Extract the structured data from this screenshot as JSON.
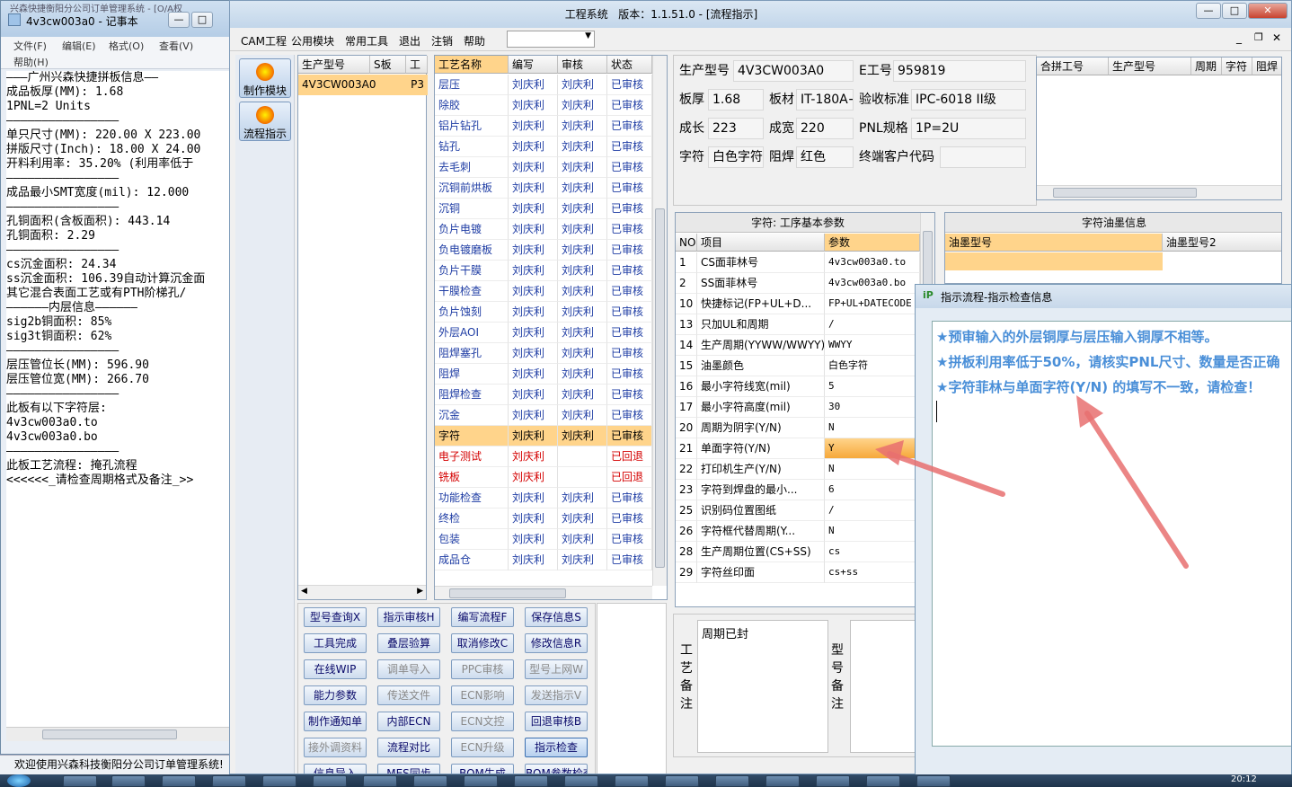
{
  "notepad": {
    "title": "4v3cw003a0 - 记事本",
    "partial_top": "兴森快捷衡阳分公司订单管理系统 - [O/A权",
    "menu": [
      "文件(F)",
      "编辑(E)",
      "格式(O)",
      "查看(V)",
      "帮助(H)"
    ],
    "lines": [
      "———广州兴森快捷拼板信息——",
      "成品板厚(MM): 1.68",
      "1PNL=2 Units",
      "————————————————",
      "单只尺寸(MM): 220.00 X 223.00",
      "拼版尺寸(Inch): 18.00 X 24.00",
      "开料利用率: 35.20% (利用率低于",
      "————————————————",
      "成品最小SMT宽度(mil): 12.000",
      "————————————————",
      "孔铜面积(含板面积): 443.14",
      "孔铜面积: 2.29",
      "————————————————",
      "cs沉金面积: 24.34",
      "ss沉金面积: 106.39自动计算沉金面",
      "其它混合表面工艺或有PTH阶梯孔/",
      "——————内层信息——————",
      "sig2b铜面积: 85%",
      "sig3t铜面积: 62%",
      "————————————————",
      "层压管位长(MM): 596.90",
      "层压管位宽(MM): 266.70",
      "————————————————",
      "此板有以下字符层:",
      "4v3cw003a0.to",
      "4v3cw003a0.bo",
      "————————————————",
      "此板工艺流程: 掩孔流程",
      "<<<<<<_请检查周期格式及备注_>>"
    ],
    "status": "欢迎使用兴森科技衡阳分公司订单管理系统!"
  },
  "main": {
    "title": "工程系统   版本：1.1.51.0 - [流程指示]",
    "menu": [
      "CAM工程",
      "公用模块",
      "常用工具",
      "退出",
      "注销",
      "帮助"
    ],
    "modules": [
      "制作模块",
      "流程指示"
    ],
    "model_grid": {
      "headers": [
        "生产型号",
        "S板",
        "工"
      ],
      "rows": [
        [
          "4V3CW003A0",
          "",
          "P3"
        ]
      ]
    },
    "process_grid": {
      "headers": [
        "工艺名称",
        "编写",
        "审核",
        "状态"
      ],
      "rows": [
        [
          "层压",
          "刘庆利",
          "刘庆利",
          "已审核"
        ],
        [
          "除胶",
          "刘庆利",
          "刘庆利",
          "已审核"
        ],
        [
          "铝片钻孔",
          "刘庆利",
          "刘庆利",
          "已审核"
        ],
        [
          "钻孔",
          "刘庆利",
          "刘庆利",
          "已审核"
        ],
        [
          "去毛刺",
          "刘庆利",
          "刘庆利",
          "已审核"
        ],
        [
          "沉铜前烘板",
          "刘庆利",
          "刘庆利",
          "已审核"
        ],
        [
          "沉铜",
          "刘庆利",
          "刘庆利",
          "已审核"
        ],
        [
          "负片电镀",
          "刘庆利",
          "刘庆利",
          "已审核"
        ],
        [
          "负电镀磨板",
          "刘庆利",
          "刘庆利",
          "已审核"
        ],
        [
          "负片干膜",
          "刘庆利",
          "刘庆利",
          "已审核"
        ],
        [
          "干膜检查",
          "刘庆利",
          "刘庆利",
          "已审核"
        ],
        [
          "负片蚀刻",
          "刘庆利",
          "刘庆利",
          "已审核"
        ],
        [
          "外层AOI",
          "刘庆利",
          "刘庆利",
          "已审核"
        ],
        [
          "阻焊塞孔",
          "刘庆利",
          "刘庆利",
          "已审核"
        ],
        [
          "阻焊",
          "刘庆利",
          "刘庆利",
          "已审核"
        ],
        [
          "阻焊检查",
          "刘庆利",
          "刘庆利",
          "已审核"
        ],
        [
          "沉金",
          "刘庆利",
          "刘庆利",
          "已审核"
        ],
        [
          "字符",
          "刘庆利",
          "刘庆利",
          "已审核"
        ],
        [
          "电子测试",
          "刘庆利",
          "",
          "已回退"
        ],
        [
          "铣板",
          "刘庆利",
          "",
          "已回退"
        ],
        [
          "功能检查",
          "刘庆利",
          "刘庆利",
          "已审核"
        ],
        [
          "终检",
          "刘庆利",
          "刘庆利",
          "已审核"
        ],
        [
          "包装",
          "刘庆利",
          "刘庆利",
          "已审核"
        ],
        [
          "成品仓",
          "刘庆利",
          "刘庆利",
          "已审核"
        ]
      ],
      "selected_index": 17,
      "reverted_indices": [
        18,
        19
      ]
    },
    "info": {
      "prod_model_label": "生产型号",
      "prod_model": "4V3CW003A0",
      "eno_label": "E工号",
      "eno": "959819",
      "thick_label": "板厚",
      "thick": "1.68",
      "material_label": "板材",
      "material": "IT-180A+",
      "standard_label": "验收标准",
      "standard": "IPC-6018 II级",
      "len_label": "成长",
      "len": "223",
      "width_label": "成宽",
      "width": "220",
      "pnl_label": "PNL规格",
      "pnl": "1P=2U",
      "char_label": "字符",
      "char": "白色字符",
      "mask_label": "阻焊",
      "mask": "红色",
      "customer_label": "终端客户代码",
      "customer": ""
    },
    "merge_grid": {
      "headers": [
        "合拼工号",
        "生产型号",
        "周期",
        "字符",
        "阻焊"
      ]
    },
    "params": {
      "title": "字符: 工序基本参数",
      "headers": [
        "NO",
        "项目",
        "参数"
      ],
      "rows": [
        [
          "1",
          "CS面菲林号",
          "4v3cw003a0.to"
        ],
        [
          "2",
          "SS面菲林号",
          "4v3cw003a0.bo"
        ],
        [
          "10",
          "快捷标记(FP+UL+D...",
          "FP+UL+DATECODE"
        ],
        [
          "13",
          "只加UL和周期",
          "/"
        ],
        [
          "14",
          "生产周期(YYWW/WWYY)",
          "WWYY"
        ],
        [
          "15",
          "油墨颜色",
          "白色字符"
        ],
        [
          "16",
          "最小字符线宽(mil)",
          "5"
        ],
        [
          "17",
          "最小字符高度(mil)",
          "30"
        ],
        [
          "20",
          "周期为阴字(Y/N)",
          "N"
        ],
        [
          "21",
          "单面字符(Y/N)",
          "Y"
        ],
        [
          "22",
          "打印机生产(Y/N)",
          "N"
        ],
        [
          "23",
          "字符到焊盘的最小...",
          "6"
        ],
        [
          "25",
          "识别码位置图纸",
          "/"
        ],
        [
          "26",
          "字符框代替周期(Y...",
          "N"
        ],
        [
          "28",
          "生产周期位置(CS+SS)",
          "cs"
        ],
        [
          "29",
          "字符丝印面",
          "cs+ss"
        ]
      ],
      "highlight_index": 9
    },
    "ink": {
      "title": "字符油墨信息",
      "headers": [
        "油墨型号",
        "油墨型号2"
      ]
    },
    "buttons": [
      [
        "型号查询X",
        "指示审核H",
        "编写流程F",
        "保存信息S"
      ],
      [
        "工具完成",
        "叠层验算",
        "取消修改C",
        "修改信息R"
      ],
      [
        "在线WIP",
        "调单导入",
        "PPC审核",
        "型号上网W"
      ],
      [
        "能力参数",
        "传送文件",
        "ECN影响",
        "发送指示V"
      ],
      [
        "制作通知单",
        "内部ECN",
        "ECN文控",
        "回退审核B"
      ],
      [
        "接外调资料",
        "流程对比",
        "ECN升级",
        "指示检查"
      ],
      [
        "信息导入",
        "MES同步",
        "BOM生成",
        "BOM参数检查"
      ]
    ],
    "disabled_buttons": [
      "调单导入",
      "PPC审核",
      "型号上网W",
      "传送文件",
      "ECN影响",
      "发送指示V",
      "ECN文控",
      "接外调资料",
      "ECN升级"
    ],
    "remark": {
      "craft_label": "工艺备注",
      "craft_text": "周期已封",
      "model_label": "型号备注"
    }
  },
  "dialog": {
    "title": "指示流程-指示检查信息",
    "messages": [
      "★预审输入的外层铜厚与层压输入铜厚不相等。",
      "★拼板利用率低于50%，请核实PNL尺寸、数量是否正确",
      "★字符菲林与单面字符(Y/N) 的填写不一致，请检查！"
    ]
  },
  "taskbar": {
    "clock": "20:12"
  },
  "colors": {
    "accent_blue": "#4a8fd8",
    "selected_row": "#ffd48b",
    "reverted": "#d40000"
  }
}
